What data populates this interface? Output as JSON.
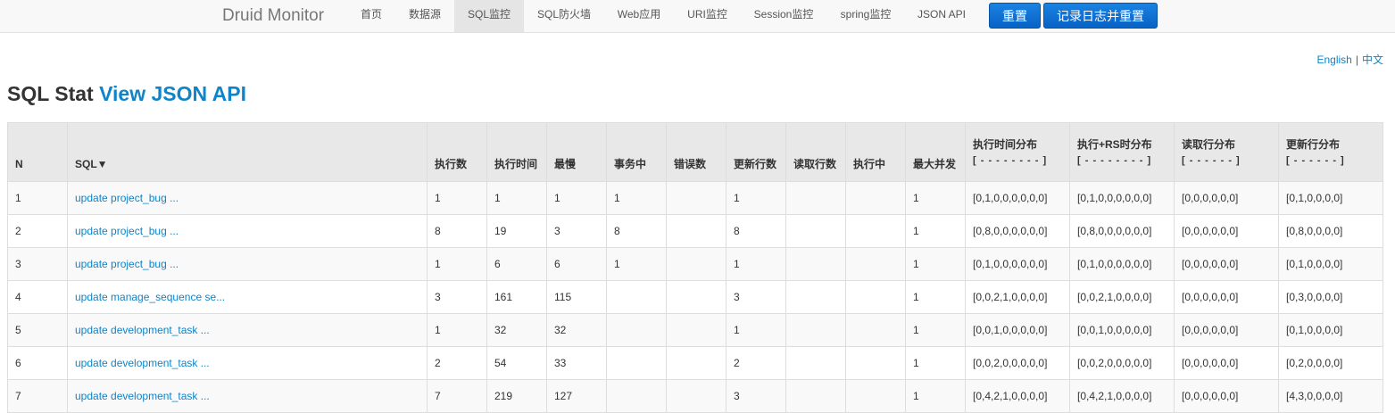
{
  "navbar": {
    "brand": "Druid Monitor",
    "items": [
      {
        "label": "首页",
        "active": false
      },
      {
        "label": "数据源",
        "active": false
      },
      {
        "label": "SQL监控",
        "active": true
      },
      {
        "label": "SQL防火墙",
        "active": false
      },
      {
        "label": "Web应用",
        "active": false
      },
      {
        "label": "URI监控",
        "active": false
      },
      {
        "label": "Session监控",
        "active": false
      },
      {
        "label": "spring监控",
        "active": false
      },
      {
        "label": "JSON API",
        "active": false
      }
    ],
    "reset_label": "重置",
    "log_reset_label": "记录日志并重置",
    "button_color": "#0a73d3"
  },
  "lang": {
    "english": "English",
    "separator": "|",
    "chinese": "中文"
  },
  "page": {
    "title": "SQL Stat",
    "json_link": "View JSON API"
  },
  "table": {
    "headers": {
      "n": "N",
      "sql": "SQL▼",
      "exec_count": "执行数",
      "exec_time": "执行时间",
      "slowest": "最慢",
      "in_txn": "事务中",
      "errors": "错误数",
      "update_rows": "更新行数",
      "fetch_rows": "读取行数",
      "running": "执行中",
      "max_concurrent": "最大并发",
      "exec_hist": "执行时间分布",
      "exec_hist_sub": "[ - - - - - - - - ]",
      "exec_rs_hist": "执行+RS时分布",
      "exec_rs_hist_sub": "[ - - - - - - - - ]",
      "fetch_hist": "读取行分布",
      "fetch_hist_sub": "[ - - - - - - ]",
      "update_hist": "更新行分布",
      "update_hist_sub": "[ - - - - - - ]"
    },
    "rows": [
      {
        "n": "1",
        "sql": "update project_bug ...",
        "exec_count": "1",
        "exec_time": "1",
        "slowest": "1",
        "in_txn": "1",
        "errors": "",
        "update_rows": "1",
        "fetch_rows": "",
        "running": "",
        "max_concurrent": "1",
        "exec_hist": "[0,1,0,0,0,0,0,0]",
        "exec_rs_hist": "[0,1,0,0,0,0,0,0]",
        "fetch_hist": "[0,0,0,0,0,0]",
        "update_hist": "[0,1,0,0,0,0]"
      },
      {
        "n": "2",
        "sql": "update project_bug ...",
        "exec_count": "8",
        "exec_time": "19",
        "slowest": "3",
        "in_txn": "8",
        "errors": "",
        "update_rows": "8",
        "fetch_rows": "",
        "running": "",
        "max_concurrent": "1",
        "exec_hist": "[0,8,0,0,0,0,0,0]",
        "exec_rs_hist": "[0,8,0,0,0,0,0,0]",
        "fetch_hist": "[0,0,0,0,0,0]",
        "update_hist": "[0,8,0,0,0,0]"
      },
      {
        "n": "3",
        "sql": "update project_bug ...",
        "exec_count": "1",
        "exec_time": "6",
        "slowest": "6",
        "in_txn": "1",
        "errors": "",
        "update_rows": "1",
        "fetch_rows": "",
        "running": "",
        "max_concurrent": "1",
        "exec_hist": "[0,1,0,0,0,0,0,0]",
        "exec_rs_hist": "[0,1,0,0,0,0,0,0]",
        "fetch_hist": "[0,0,0,0,0,0]",
        "update_hist": "[0,1,0,0,0,0]"
      },
      {
        "n": "4",
        "sql": "update manage_sequence se...",
        "exec_count": "3",
        "exec_time": "161",
        "slowest": "115",
        "in_txn": "",
        "errors": "",
        "update_rows": "3",
        "fetch_rows": "",
        "running": "",
        "max_concurrent": "1",
        "exec_hist": "[0,0,2,1,0,0,0,0]",
        "exec_rs_hist": "[0,0,2,1,0,0,0,0]",
        "fetch_hist": "[0,0,0,0,0,0]",
        "update_hist": "[0,3,0,0,0,0]"
      },
      {
        "n": "5",
        "sql": "update development_task ...",
        "exec_count": "1",
        "exec_time": "32",
        "slowest": "32",
        "in_txn": "",
        "errors": "",
        "update_rows": "1",
        "fetch_rows": "",
        "running": "",
        "max_concurrent": "1",
        "exec_hist": "[0,0,1,0,0,0,0,0]",
        "exec_rs_hist": "[0,0,1,0,0,0,0,0]",
        "fetch_hist": "[0,0,0,0,0,0]",
        "update_hist": "[0,1,0,0,0,0]"
      },
      {
        "n": "6",
        "sql": "update development_task ...",
        "exec_count": "2",
        "exec_time": "54",
        "slowest": "33",
        "in_txn": "",
        "errors": "",
        "update_rows": "2",
        "fetch_rows": "",
        "running": "",
        "max_concurrent": "1",
        "exec_hist": "[0,0,2,0,0,0,0,0]",
        "exec_rs_hist": "[0,0,2,0,0,0,0,0]",
        "fetch_hist": "[0,0,0,0,0,0]",
        "update_hist": "[0,2,0,0,0,0]"
      },
      {
        "n": "7",
        "sql": "update development_task ...",
        "exec_count": "7",
        "exec_time": "219",
        "slowest": "127",
        "in_txn": "",
        "errors": "",
        "update_rows": "3",
        "fetch_rows": "",
        "running": "",
        "max_concurrent": "1",
        "exec_hist": "[0,4,2,1,0,0,0,0]",
        "exec_rs_hist": "[0,4,2,1,0,0,0,0]",
        "fetch_hist": "[0,0,0,0,0,0]",
        "update_hist": "[4,3,0,0,0,0]"
      }
    ]
  }
}
